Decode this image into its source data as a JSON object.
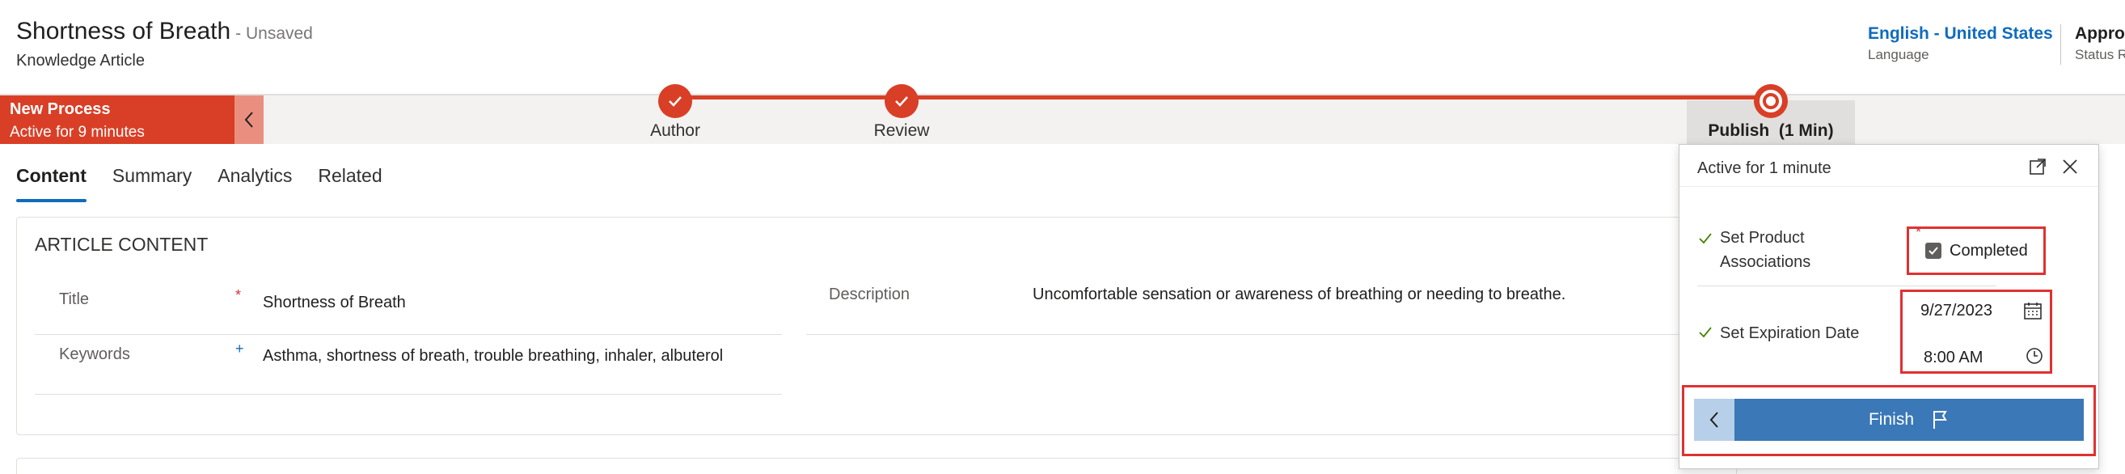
{
  "header": {
    "title": "Shortness of Breath",
    "unsaved": "- Unsaved",
    "entity_type": "Knowledge Article",
    "language_value": "English - United States",
    "language_label": "Language",
    "status_value": "Approved",
    "status_label": "Status Reason"
  },
  "bpf": {
    "process_name": "New Process",
    "process_active": "Active for 9 minutes",
    "stages": [
      {
        "label": "Author",
        "state": "completed"
      },
      {
        "label": "Review",
        "state": "completed"
      },
      {
        "label": "Publish",
        "duration": "(1 Min)",
        "state": "active"
      }
    ],
    "accent_color": "#d93f26"
  },
  "tabs": [
    {
      "label": "Content",
      "active": true
    },
    {
      "label": "Summary",
      "active": false
    },
    {
      "label": "Analytics",
      "active": false
    },
    {
      "label": "Related",
      "active": false
    }
  ],
  "article": {
    "section_title": "ARTICLE CONTENT",
    "title_label": "Title",
    "title_value": "Shortness of Breath",
    "keywords_label": "Keywords",
    "keywords_value": "Asthma, shortness of breath, trouble breathing, inhaler, albuterol",
    "description_label": "Description",
    "description_value": "Uncomfortable sensation or awareness of breathing or needing to breathe.",
    "required_marker": "*",
    "recommended_marker": "+"
  },
  "flyout": {
    "active_text": "Active for 1 minute",
    "steps": [
      {
        "label_line1": "Set Product",
        "label_line2": "Associations",
        "required": "*",
        "value": "Completed",
        "checked": true
      },
      {
        "label": "Set Expiration Date",
        "date": "9/27/2023",
        "time": "8:00 AM"
      }
    ],
    "finish_label": "Finish",
    "icons": [
      "expand-icon",
      "close-icon",
      "check-icon",
      "calendar-icon",
      "clock-icon",
      "chevron-left-icon",
      "flag-icon"
    ]
  }
}
